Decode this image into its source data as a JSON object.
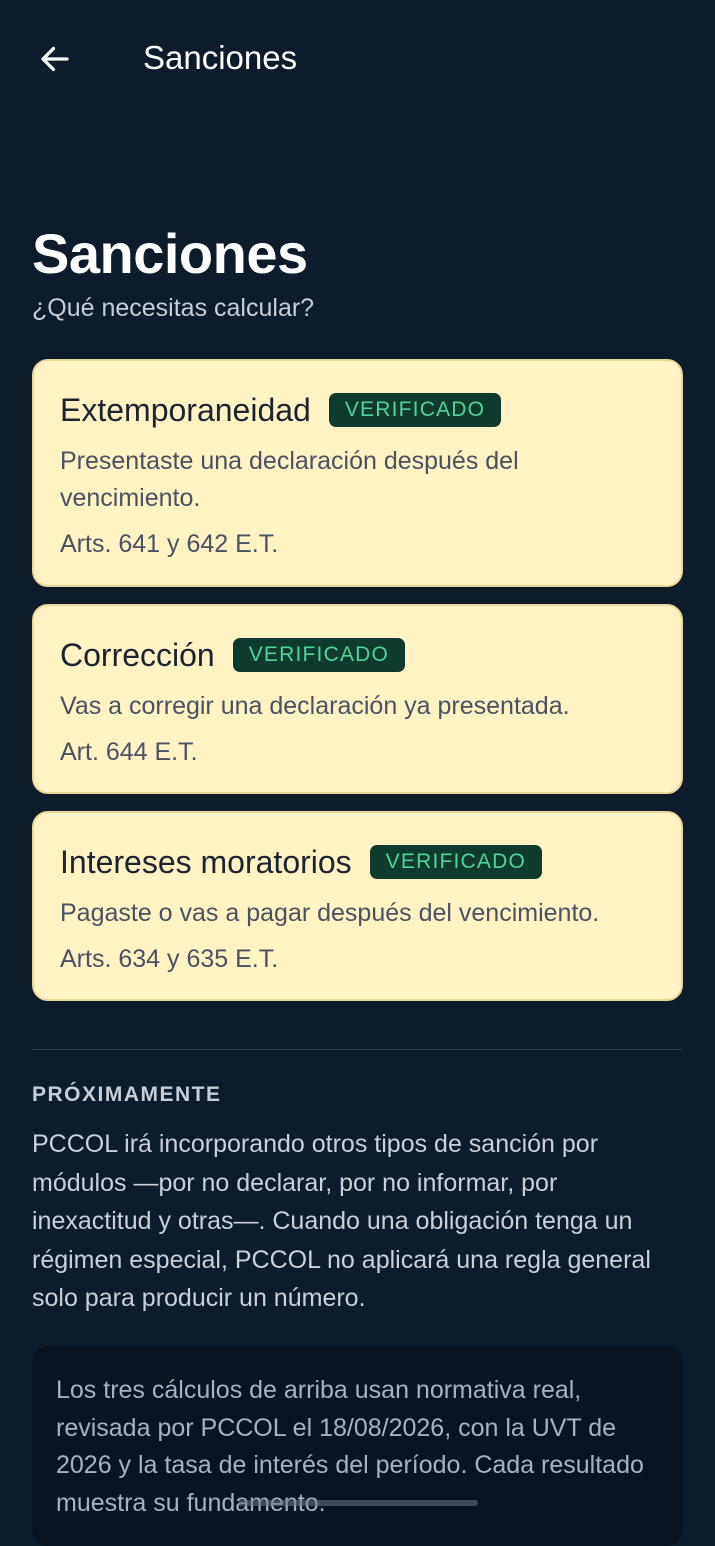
{
  "header": {
    "back_icon": "arrow-left-icon",
    "title": "Sanciones"
  },
  "page": {
    "title": "Sanciones",
    "subtitle": "¿Qué necesitas calcular?"
  },
  "cards": [
    {
      "title": "Extemporaneidad",
      "badge": "VERIFICADO",
      "description": "Presentaste una declaración después del vencimiento.",
      "reference": "Arts. 641 y 642 E.T."
    },
    {
      "title": "Corrección",
      "badge": "VERIFICADO",
      "description": "Vas a corregir una declaración ya presentada.",
      "reference": "Art. 644 E.T."
    },
    {
      "title": "Intereses moratorios",
      "badge": "VERIFICADO",
      "description": "Pagaste o vas a pagar después del vencimiento.",
      "reference": "Arts. 634 y 635 E.T."
    }
  ],
  "upcoming": {
    "label": "PRÓXIMAMENTE",
    "text": "PCCOL irá incorporando otros tipos de sanción por módulos —por no declarar, por no informar, por inexactitud y otras—. Cuando una obligación tenga un régimen especial, PCCOL no aplicará una regla general solo para producir un número."
  },
  "note": {
    "text": "Los tres cálculos de arriba usan normativa real, revisada por PCCOL el 18/08/2026, con la UVT de 2026 y la tasa de interés del período. Cada resultado muestra su fundamento."
  },
  "colors": {
    "background": "#0d1b2b",
    "card": "#fff3c4",
    "badge_bg": "#0f3b2e",
    "badge_text": "#4fd39a"
  }
}
